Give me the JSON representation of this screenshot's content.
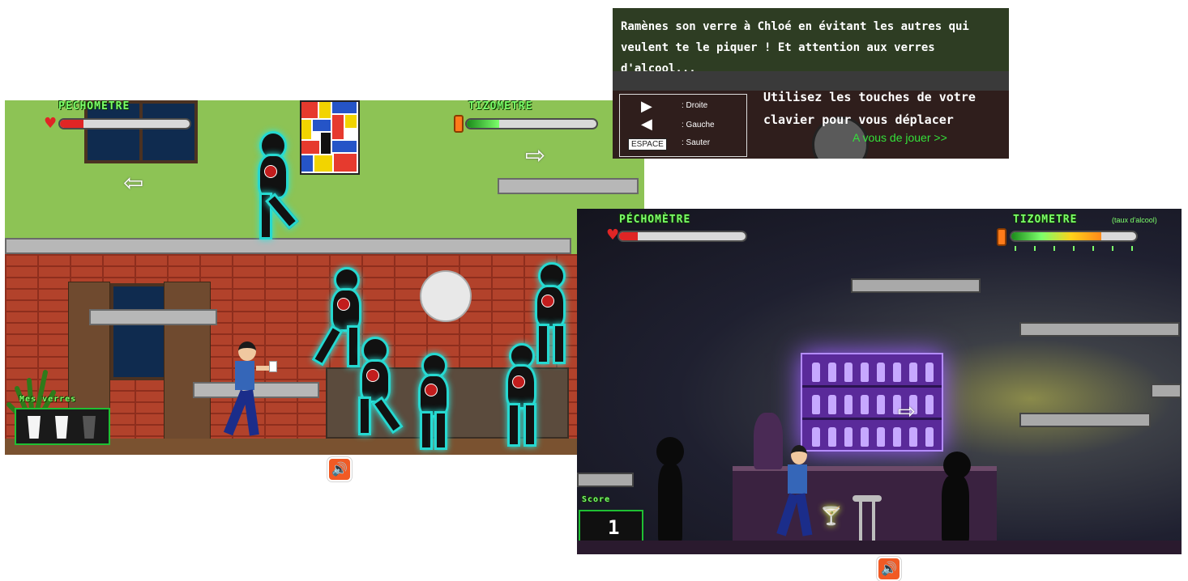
{
  "left_game": {
    "pechometre_label": "PÉCHOMETRE",
    "pechometre_level": 0.18,
    "tizometre_label": "TIZOMETRE",
    "tizometre_level": 0.25,
    "cups_label": "Mes verres",
    "sound_icon": "speaker-icon"
  },
  "instructions": {
    "mission": "Ramènes son verre à Chloé en évitant les autres qui veulent te le piquer ! Et attention aux verres d'alcool...",
    "controls_title": "Utilisez les touches de votre clavier pour vous déplacer",
    "keys": [
      {
        "symbol": "▶",
        "label": ": Droite"
      },
      {
        "symbol": "◀",
        "label": ": Gauche"
      },
      {
        "symbol": "ESPACE",
        "label": ": Sauter"
      }
    ],
    "play_link": "A vous de jouer >>"
  },
  "right_game": {
    "pechometre_label": "PÉCHOMÈTRE",
    "pechometre_level": 0.15,
    "tizometre_label": "TIZOMETRE",
    "tizometre_level": 0.72,
    "tizometre_note": "(taux d'alcool)",
    "score_label": "Score",
    "score_value": "1",
    "sound_icon": "speaker-icon"
  },
  "colors": {
    "meter_green": "#7cff6b",
    "fill_red": "#e02525",
    "link_green": "#34e03a",
    "glow_cyan": "#2ae8e0"
  }
}
